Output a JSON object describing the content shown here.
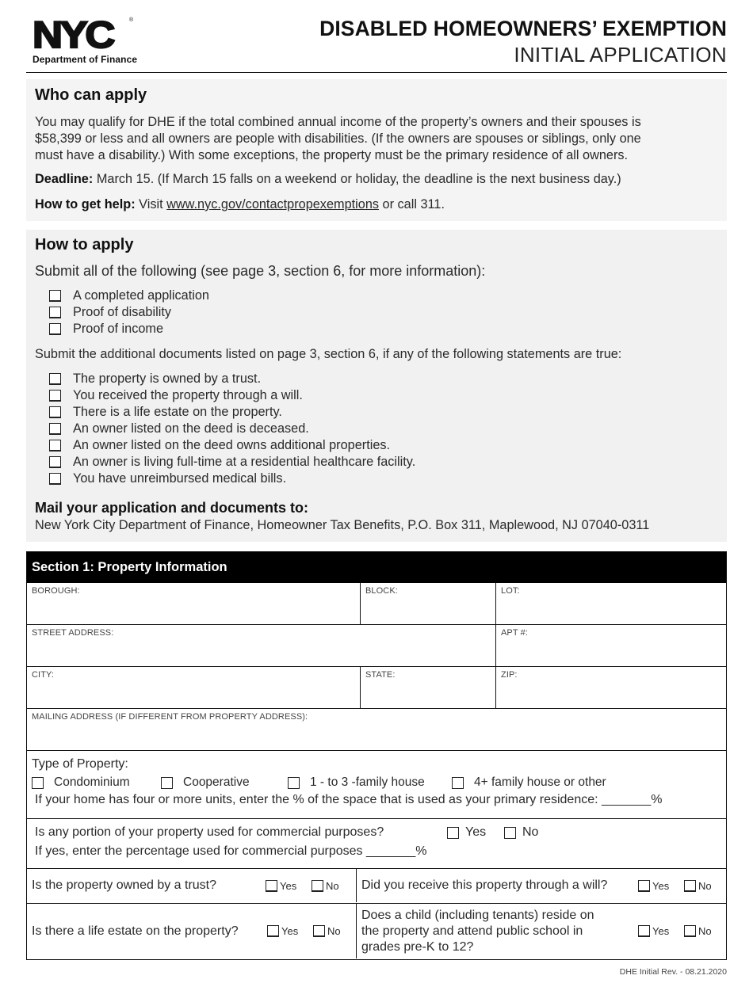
{
  "header": {
    "logo_text": "NYC",
    "logo_reg": "®",
    "department": "Department of Finance",
    "title": "DISABLED HOMEOWNERS’ EXEMPTION",
    "subtitle": "INITIAL APPLICATION"
  },
  "who_can_apply": {
    "heading": "Who can apply",
    "body_lines": [
      "You may qualify for DHE if the total combined annual income of the property’s owners and their spouses is",
      "$58,399 or less and all owners are people with disabilities. (If the owners are spouses or siblings, only one",
      "must have a disability.) With some exceptions, the property must be the primary residence of all owners."
    ],
    "deadline_label": "Deadline:",
    "deadline_text": " March 15. (If March 15 falls on a weekend or holiday, the deadline is the next business day.)",
    "help_label": "How to get help:",
    "help_pre": " Visit ",
    "help_link": "www.nyc.gov/contactpropexemptions",
    "help_post": " or call 311."
  },
  "how_to_apply": {
    "heading": "How to apply",
    "intro": "Submit all of the following (see page 3, section 6, for more information):",
    "required_items": [
      "A completed application",
      "Proof of disability",
      "Proof of income"
    ],
    "additional_intro": "Submit the additional documents listed on page 3, section 6, if any of the following statements are true:",
    "additional_items": [
      "The property is owned by a trust.",
      "You received the property through a will.",
      "There is a life estate on the property.",
      "An owner listed on the deed is deceased.",
      "An owner listed on the deed owns additional properties.",
      "An owner is living full-time at a residential healthcare facility.",
      "You have unreimbursed medical bills."
    ],
    "mail_heading": "Mail your application and documents to:",
    "mail_address": "New York City Department of Finance, Homeowner Tax Benefits, P.O. Box 311, Maplewood, NJ  07040-0311"
  },
  "section1": {
    "title": "Section 1: Property Information",
    "fields": {
      "borough": "BOROUGH:",
      "block": "BLOCK:",
      "lot": "LOT:",
      "street": "STREET ADDRESS:",
      "apt": "APT #:",
      "city": "CITY:",
      "state": "STATE:",
      "zip": "ZIP:",
      "mailing": "MAILING ADDRESS (IF DIFFERENT FROM PROPERTY ADDRESS):"
    },
    "type_of_property": {
      "label": "Type of Property:",
      "options": [
        "Condominium",
        "Cooperative",
        "1 - to 3 -family house",
        "4+ family house or other"
      ],
      "note": "If your home has four or more units, enter the % of the space that is used as your primary residence: _______%"
    },
    "commercial": {
      "question": "Is any portion of your property used for commercial purposes?",
      "yes": "Yes",
      "no": "No",
      "followup": "If yes, enter the percentage used for commercial purposes _______%"
    },
    "questions": [
      {
        "text": "Is the property owned by a trust?",
        "yes": "Yes",
        "no": "No"
      },
      {
        "text": "Did you receive this property through a will?",
        "yes": "Yes",
        "no": "No"
      },
      {
        "text": "Is there a life estate on the property?",
        "yes": "Yes",
        "no": "No"
      },
      {
        "text_lines": [
          "Does a child (including tenants) reside on",
          "the property and attend public school in",
          "grades pre-K to 12?"
        ],
        "yes": "Yes",
        "no": "No"
      }
    ]
  },
  "footer": {
    "revision": "DHE Initial Rev. - 08.21.2020"
  }
}
